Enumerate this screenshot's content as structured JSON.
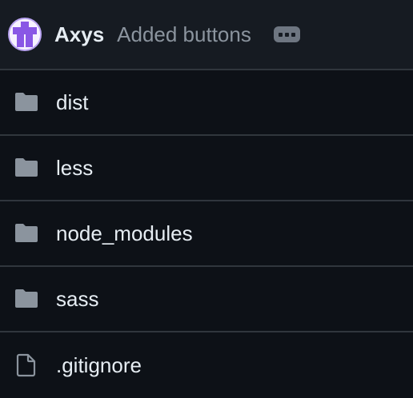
{
  "colors": {
    "background": "#0d1117",
    "header_background": "#161b22",
    "border": "#30363d",
    "primary_text": "#e6edf3",
    "secondary_text": "#8b949e",
    "icon": "#8b949e",
    "avatar_accent": "#8957e5"
  },
  "commit": {
    "avatar_icon": "identicon-avatar",
    "author": "Axys",
    "message": "Added buttons",
    "more_icon": "ellipsis-icon"
  },
  "entries": [
    {
      "name": "dist",
      "type": "folder",
      "icon": "folder-icon"
    },
    {
      "name": "less",
      "type": "folder",
      "icon": "folder-icon"
    },
    {
      "name": "node_modules",
      "type": "folder",
      "icon": "folder-icon"
    },
    {
      "name": "sass",
      "type": "folder",
      "icon": "folder-icon"
    },
    {
      "name": ".gitignore",
      "type": "file",
      "icon": "file-icon"
    }
  ]
}
